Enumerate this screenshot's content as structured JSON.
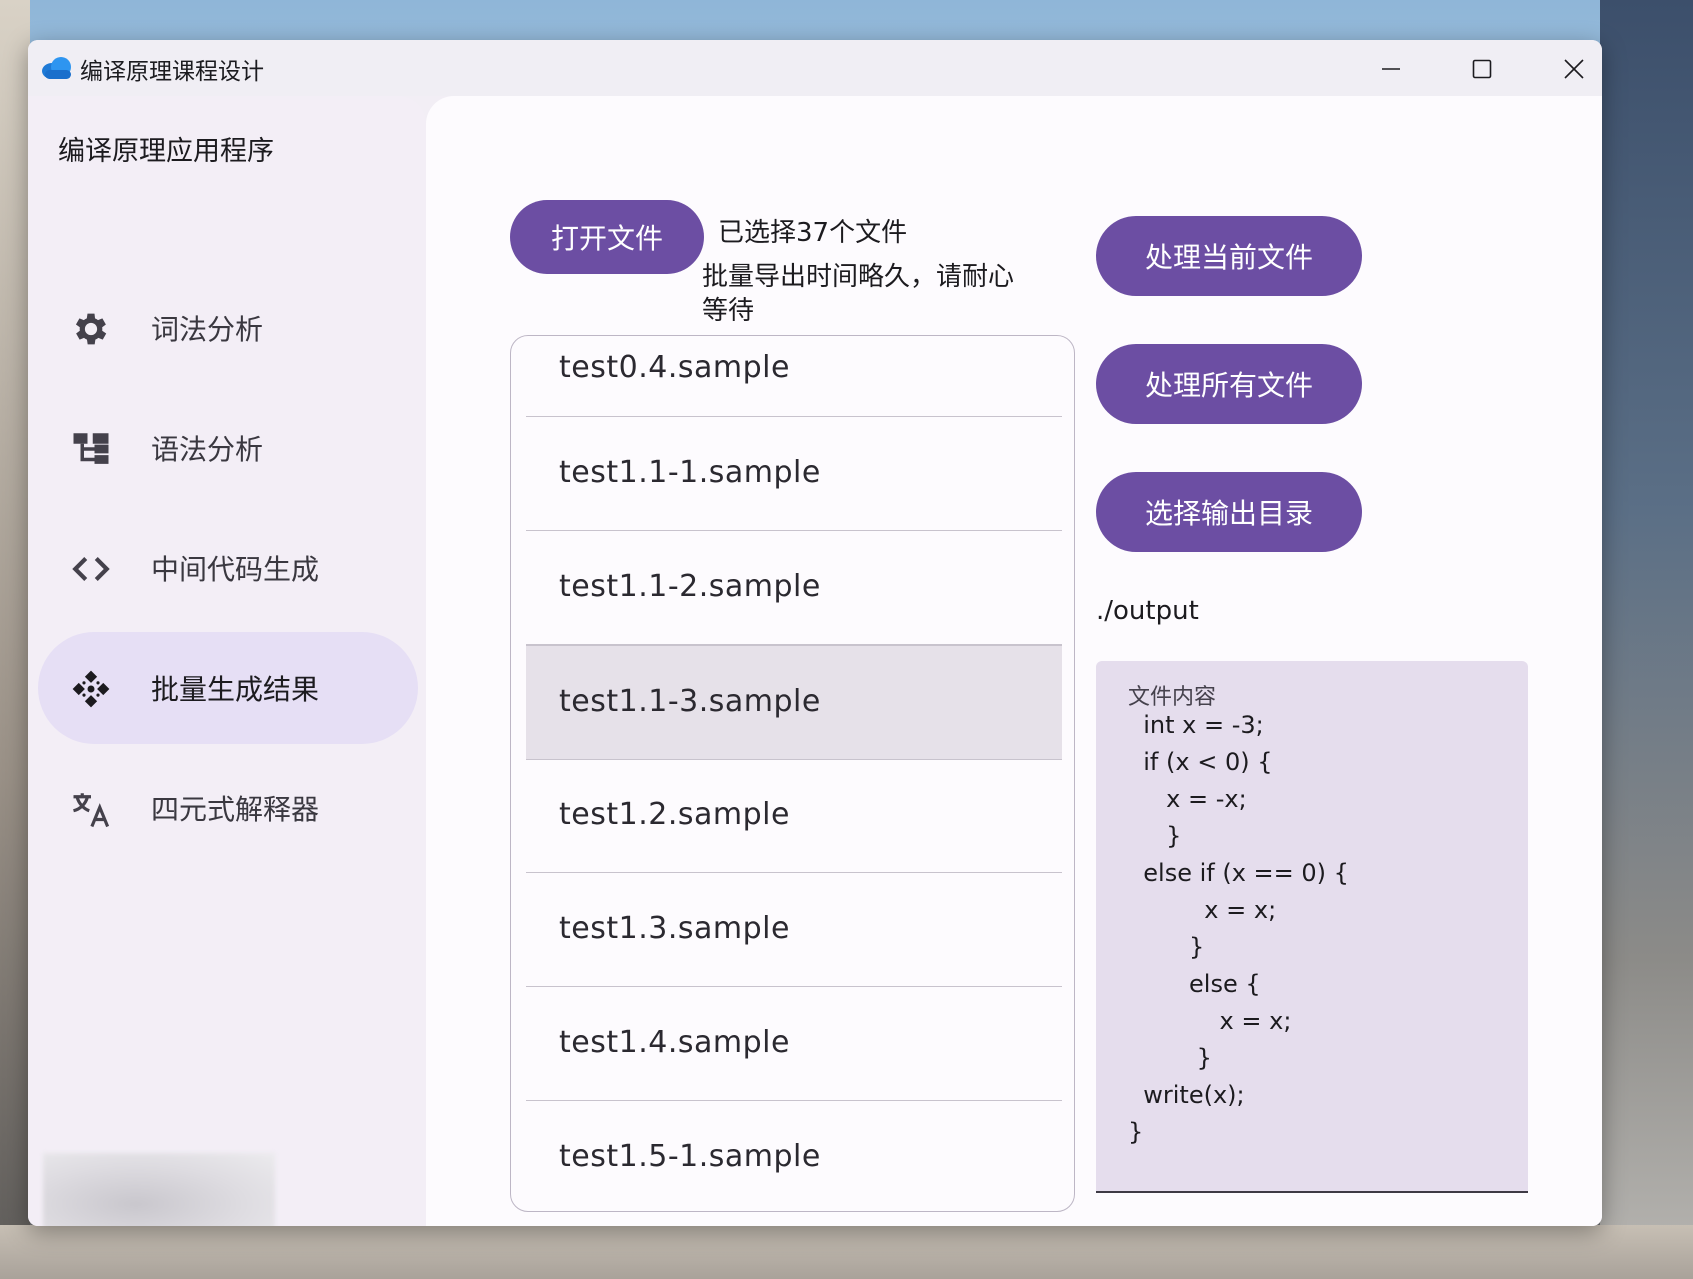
{
  "window": {
    "title": "编译原理课程设计",
    "controls": {
      "minimize": "minimize",
      "maximize": "maximize",
      "close": "close"
    }
  },
  "sidebar": {
    "app_title": "编译原理应用程序",
    "items": [
      {
        "label": "词法分析",
        "icon": "gear-icon",
        "active": false
      },
      {
        "label": "语法分析",
        "icon": "tree-structure-icon",
        "active": false
      },
      {
        "label": "中间代码生成",
        "icon": "code-brackets-icon",
        "active": false
      },
      {
        "label": "批量生成结果",
        "icon": "diamond-dots-icon",
        "active": true
      },
      {
        "label": "四元式解释器",
        "icon": "translate-icon",
        "active": false
      }
    ]
  },
  "main": {
    "open_file_button": "打开文件",
    "selected_count_text": "已选择37个文件",
    "export_note": "批量导出时间略久，请耐心等待",
    "files": [
      "test0.4.sample",
      "test1.1-1.sample",
      "test1.1-2.sample",
      "test1.1-3.sample",
      "test1.2.sample",
      "test1.3.sample",
      "test1.4.sample",
      "test1.5-1.sample"
    ],
    "hovered_file_index": 3,
    "process_current_button": "处理当前文件",
    "process_all_button": "处理所有文件",
    "choose_output_button": "选择输出目录",
    "output_path": "./output",
    "file_content_label": "文件内容",
    "file_content": "  int x = -3;\n  if (x < 0) {\n     x = -x;\n     }\n  else if (x == 0) {\n          x = x;\n        }\n        else {\n            x = x;\n         }\n  write(x);\n}"
  },
  "colors": {
    "accent": "#6c4ea3",
    "nav_active_bg": "#e6dff5",
    "content_box_bg": "#e5dded",
    "hover_row_bg": "#e6e1e9"
  }
}
